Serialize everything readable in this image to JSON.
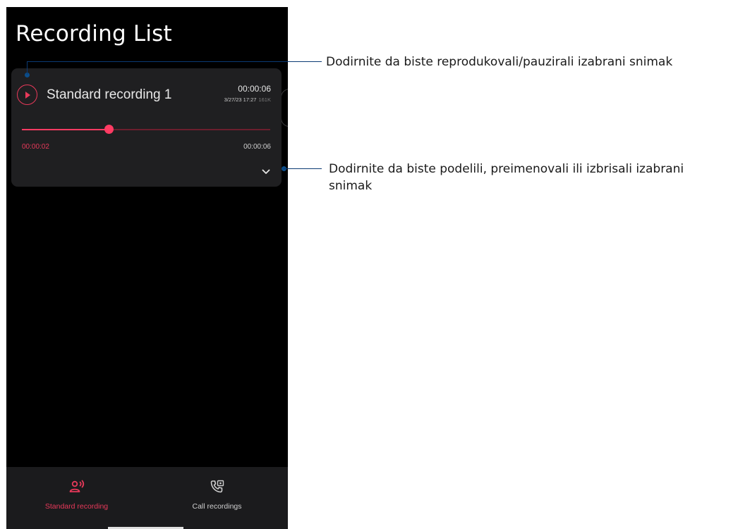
{
  "screen": {
    "title": "Recording List"
  },
  "recording": {
    "name": "Standard recording 1",
    "duration": "00:00:06",
    "date": "3/27/23 17:27",
    "size": "161K",
    "current_time": "00:00:02",
    "end_time": "00:00:06",
    "progress": 0.35
  },
  "bottom_nav": {
    "items": [
      {
        "label": "Standard recording",
        "icon": "voice-recording-icon",
        "active": true
      },
      {
        "label": "Call recordings",
        "icon": "phone-recording-icon",
        "active": false
      }
    ]
  },
  "callouts": [
    {
      "text": "Dodirnite da biste reprodukovali/pauzirali izabrani snimak"
    },
    {
      "text": "Dodirnite da biste podelili, preimenovali ili izbrisali izabrani snimak"
    }
  ],
  "colors": {
    "accent": "#e8395a",
    "progress": "#ff3b63",
    "callout": "#0b3a73"
  }
}
